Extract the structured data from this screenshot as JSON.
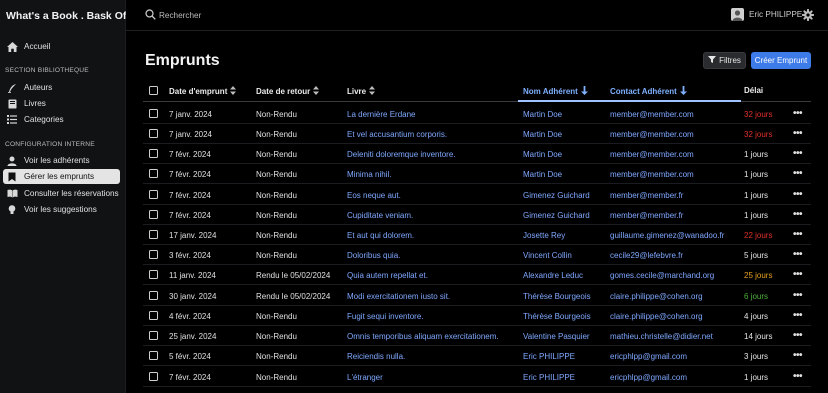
{
  "app": {
    "brand": "What's a Book . Bask Office"
  },
  "sidebar": {
    "home": "Accueil",
    "section_library": "SECTION BIBLIOTHEQUE",
    "library_items": [
      "Auteurs",
      "Livres",
      "Categories"
    ],
    "section_config": "CONFIGURATION INTERNE",
    "config_items": [
      "Voir les adhérents",
      "Gérer les emprunts",
      "Consulter les réservations",
      "Voir les suggestions"
    ]
  },
  "topbar": {
    "search_placeholder": "Rechercher",
    "user_name": "Eric PHILIPPE"
  },
  "page": {
    "title": "Emprunts",
    "filters_label": "Filtres",
    "create_label": "Créer Emprunt"
  },
  "table": {
    "headers": {
      "date_emprunt": "Date d'emprunt",
      "date_retour": "Date de retour",
      "livre": "Livre",
      "nom_adherent": "Nom Adhérent",
      "contact_adherent": "Contact Adhérent",
      "delai": "Délai"
    },
    "rows": [
      {
        "date": "7 janv. 2024",
        "retour": "Non-Rendu",
        "livre": "La dernière Erdane",
        "nom": "Martin Doe",
        "contact": "member@member.com",
        "delai": "32 jours",
        "delai_color": "#e0302a"
      },
      {
        "date": "7 janv. 2024",
        "retour": "Non-Rendu",
        "livre": "Et vel accusantium corporis.",
        "nom": "Martin Doe",
        "contact": "member@member.com",
        "delai": "32 jours",
        "delai_color": "#e0302a"
      },
      {
        "date": "7 févr. 2024",
        "retour": "Non-Rendu",
        "livre": "Deleniti doloremque inventore.",
        "nom": "Martin Doe",
        "contact": "member@member.com",
        "delai": "1 jours",
        "delai_color": "#e6e6e6"
      },
      {
        "date": "7 févr. 2024",
        "retour": "Non-Rendu",
        "livre": "Minima nihil.",
        "nom": "Martin Doe",
        "contact": "member@member.com",
        "delai": "1 jours",
        "delai_color": "#e6e6e6"
      },
      {
        "date": "7 févr. 2024",
        "retour": "Non-Rendu",
        "livre": "Eos neque aut.",
        "nom": "Gimenez Guichard",
        "contact": "member@member.fr",
        "delai": "1 jours",
        "delai_color": "#e6e6e6"
      },
      {
        "date": "7 févr. 2024",
        "retour": "Non-Rendu",
        "livre": "Cupiditate veniam.",
        "nom": "Gimenez Guichard",
        "contact": "member@member.fr",
        "delai": "1 jours",
        "delai_color": "#e6e6e6"
      },
      {
        "date": "17 janv. 2024",
        "retour": "Non-Rendu",
        "livre": "Et aut qui dolorem.",
        "nom": "Josette Rey",
        "contact": "guillaume.gimenez@wanadoo.fr",
        "delai": "22 jours",
        "delai_color": "#e0302a"
      },
      {
        "date": "3 févr. 2024",
        "retour": "Non-Rendu",
        "livre": "Doloribus quia.",
        "nom": "Vincent Collin",
        "contact": "cecile29@lefebvre.fr",
        "delai": "5 jours",
        "delai_color": "#e6e6e6"
      },
      {
        "date": "11 janv. 2024",
        "retour": "Rendu le 05/02/2024",
        "livre": "Quia autem repellat et.",
        "nom": "Alexandre Leduc",
        "contact": "gomes.cecile@marchand.org",
        "delai": "25 jours",
        "delai_color": "#e8a21c"
      },
      {
        "date": "30 janv. 2024",
        "retour": "Rendu le 05/02/2024",
        "livre": "Modi exercitationem iusto sit.",
        "nom": "Thérèse Bourgeois",
        "contact": "claire.philippe@cohen.org",
        "delai": "6 jours",
        "delai_color": "#4caf3a"
      },
      {
        "date": "4 févr. 2024",
        "retour": "Non-Rendu",
        "livre": "Fugit sequi inventore.",
        "nom": "Thérèse Bourgeois",
        "contact": "claire.philippe@cohen.org",
        "delai": "4 jours",
        "delai_color": "#e6e6e6"
      },
      {
        "date": "25 janv. 2024",
        "retour": "Non-Rendu",
        "livre": "Omnis temporibus aliquam exercitationem.",
        "nom": "Valentine Pasquier",
        "contact": "mathieu.christelle@didier.net",
        "delai": "14 jours",
        "delai_color": "#e6e6e6"
      },
      {
        "date": "5 févr. 2024",
        "retour": "Non-Rendu",
        "livre": "Reiciendis nulla.",
        "nom": "Eric PHILIPPE",
        "contact": "ericphlpp@gmail.com",
        "delai": "3 jours",
        "delai_color": "#e6e6e6"
      },
      {
        "date": "7 févr. 2024",
        "retour": "Non-Rendu",
        "livre": "L'étranger",
        "nom": "Eric PHILIPPE",
        "contact": "ericphlpp@gmail.com",
        "delai": "1 jours",
        "delai_color": "#e6e6e6"
      }
    ]
  }
}
